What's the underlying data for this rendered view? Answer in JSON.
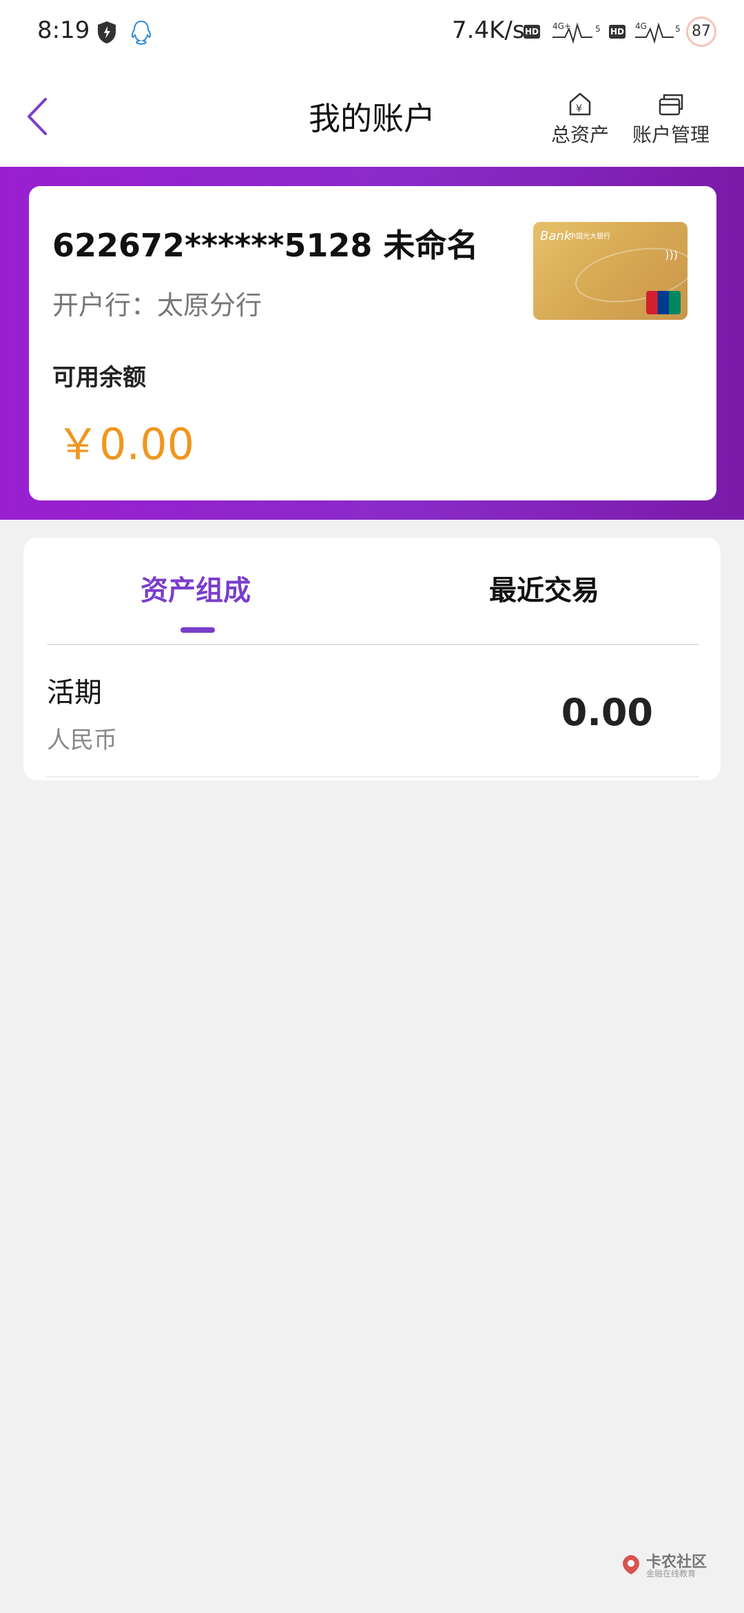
{
  "status_bar": {
    "time": "8:19",
    "speed": "7.4K/s",
    "hd_label": "HD",
    "net1": "4G+",
    "net2": "4G",
    "sig_num": "5",
    "battery": "87"
  },
  "header": {
    "title": "我的账户",
    "total_assets": "总资产",
    "account_mgmt": "账户管理"
  },
  "account": {
    "number": "622672******5128 未命名",
    "branch": "开户行：太原分行",
    "balance_label": "可用余额",
    "balance_value": "￥0.00"
  },
  "bank_card": {
    "brand": "Bank",
    "bank_name": "中国光大银行",
    "union_pay": "UnionPay"
  },
  "tabs": [
    {
      "label": "资产组成",
      "active": true
    },
    {
      "label": "最近交易",
      "active": false
    }
  ],
  "assets": [
    {
      "title": "活期",
      "currency": "人民币",
      "value": "0.00"
    }
  ],
  "watermark": {
    "title": "卡农社区",
    "subtitle": "金融在线教育"
  },
  "colors": {
    "accent": "#7a3ec9",
    "band": "#8a2bc9",
    "balance": "#f0961e"
  }
}
